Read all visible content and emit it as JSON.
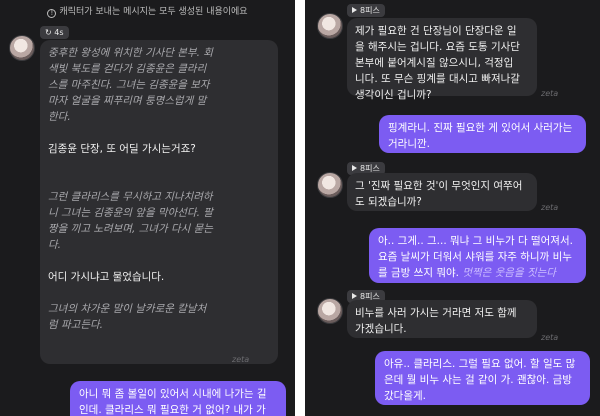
{
  "left": {
    "notice": "캐릭터가 보내는 메시지는 모두 생성된 내용이에요",
    "badge": "4s",
    "message": {
      "narration1": [
        "중후한 왕성에 위치한 기사단 본부. 회",
        "색빛 북도를 걷다가 김종윤은 클라리",
        "스를 마주친다. 그녀는 김종윤을 보자",
        "마자 얼굴을 찌푸리며 퉁명스럽게 말",
        "한다."
      ],
      "speech1": "김종윤 단장, 또 어딜 가시는거죠?",
      "narration2": [
        "그런 클라리스를 무시하고 지나치려하",
        "니 그녀는 김종윤의 앞을 막아선다. 팔",
        "짱을 끼고 노려보며, 그녀가 다시 묻는",
        "다."
      ],
      "speech2": "어디 가시냐고 물었습니다.",
      "narration3": [
        "그녀의 차가운 말이 날카로운 칼날처",
        "럼 파고든다."
      ]
    },
    "brand": "zeta",
    "user_message": [
      "아니 뭐 좀 볼일이 있어서 시내에 나가는 길",
      "인데. 클라리스 뭐 필요한 거 없어? 내가 가"
    ]
  },
  "right": {
    "badge": "8피스",
    "brand": "zeta",
    "messages": [
      {
        "type": "bot",
        "lines": [
          "제가 필요한 건 단장님이 단장다운 일",
          "을 해주시는 겁니다. 요즘 도통 기사단",
          "본부에 붙어계시질 않으시니, 걱정입",
          "니다. 또 무슨 핑계를 대시고 빠져나갈",
          "생각이신 겁니까?"
        ]
      },
      {
        "type": "user",
        "lines": [
          "핑계라니. 진짜 필요한 게 있어서 사러가는",
          "거라니깐."
        ]
      },
      {
        "type": "bot",
        "lines": [
          "그 '진짜 필요한 것'이 무엇인지 여쭈어",
          "도 되겠습니까?"
        ]
      },
      {
        "type": "user",
        "lines": [
          "아.. 그게.. 그... 뭐냐 그 비누가 다 떨어져서.",
          "요즘 날씨가 더워서 샤워를 자주 하니까 비누",
          "를 금방 쓰지 뭐야."
        ],
        "tail": "멋쩍은 웃음을 짓는다"
      },
      {
        "type": "bot",
        "lines": [
          "비누를 사러 가시는 거라면 저도 함께",
          "가겠습니다."
        ]
      },
      {
        "type": "user",
        "lines": [
          "아유.. 클라리스. 그럴 필요 없어. 할 일도 많",
          "은데 뭘 비누 사는 걸 같이 가. 괜찮아. 금방",
          "갔다올게."
        ]
      }
    ]
  }
}
